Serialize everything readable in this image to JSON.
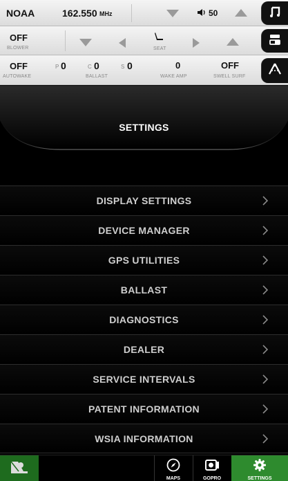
{
  "status_bar": {
    "radio": {
      "source": "NOAA",
      "frequency": "162.550",
      "frequency_unit": "MHz",
      "volume": "50"
    },
    "blower": {
      "value": "OFF",
      "label": "BLOWER"
    },
    "seat": {
      "label": "SEAT"
    },
    "autowake": {
      "value": "OFF",
      "label": "AUTOWAKE"
    },
    "ballast": {
      "label": "BALLAST",
      "port_prefix": "P",
      "port_value": "0",
      "center_prefix": "C",
      "center_value": "0",
      "starboard_prefix": "S",
      "starboard_value": "0"
    },
    "wake_amp": {
      "value": "0",
      "label": "WAKE AMP"
    },
    "swell_surf": {
      "value": "OFF",
      "label": "SWELL SURF"
    }
  },
  "header": {
    "title": "SETTINGS"
  },
  "menu": {
    "items": [
      {
        "label": "DISPLAY SETTINGS"
      },
      {
        "label": "DEVICE MANAGER"
      },
      {
        "label": "GPS UTILITIES"
      },
      {
        "label": "BALLAST"
      },
      {
        "label": "DIAGNOSTICS"
      },
      {
        "label": "DEALER"
      },
      {
        "label": "SERVICE INTERVALS"
      },
      {
        "label": "PATENT INFORMATION"
      },
      {
        "label": "WSIA INFORMATION"
      }
    ]
  },
  "bottom_nav": {
    "maps": "MAPS",
    "gopro": "GOPRO",
    "settings": "SETTINGS"
  },
  "colors": {
    "active_tab": "#2e8b2e",
    "menu_text": "#cfcfcf",
    "background": "#000000"
  },
  "icons": [
    "music-icon",
    "speaker-icon",
    "seat-icon",
    "panel-icon",
    "wake-icon",
    "chevron-right-icon",
    "boat-icon",
    "compass-icon",
    "camera-icon",
    "gear-icon"
  ]
}
